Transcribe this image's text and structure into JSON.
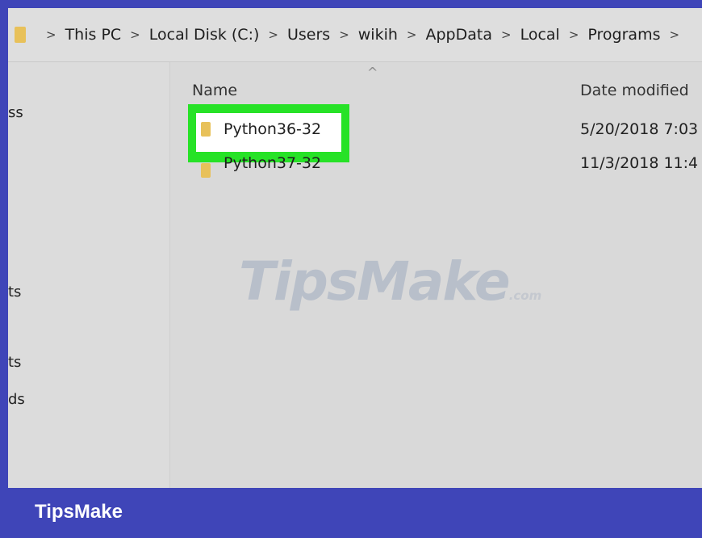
{
  "breadcrumb": {
    "items": [
      "This PC",
      "Local Disk (C:)",
      "Users",
      "wikih",
      "AppData",
      "Local",
      "Programs"
    ],
    "separator": ">"
  },
  "nav_pane": {
    "items": [
      "ss",
      "ts",
      "ts",
      "ds"
    ]
  },
  "file_list": {
    "columns": {
      "name": "Name",
      "date_modified": "Date modified"
    },
    "sort_indicator": "^",
    "rows": [
      {
        "name": "Python36-32",
        "date": "5/20/2018 7:03",
        "highlighted": true
      },
      {
        "name": "Python37-32",
        "date": "11/3/2018 11:4",
        "highlighted": false
      }
    ]
  },
  "watermark": {
    "brand": "TipsMake",
    "suffix": ".com"
  },
  "footer": {
    "brand": "TipsMake"
  },
  "colors": {
    "frame": "#3f45b8",
    "highlight": "#27e227",
    "folder": "#e8c15a"
  }
}
